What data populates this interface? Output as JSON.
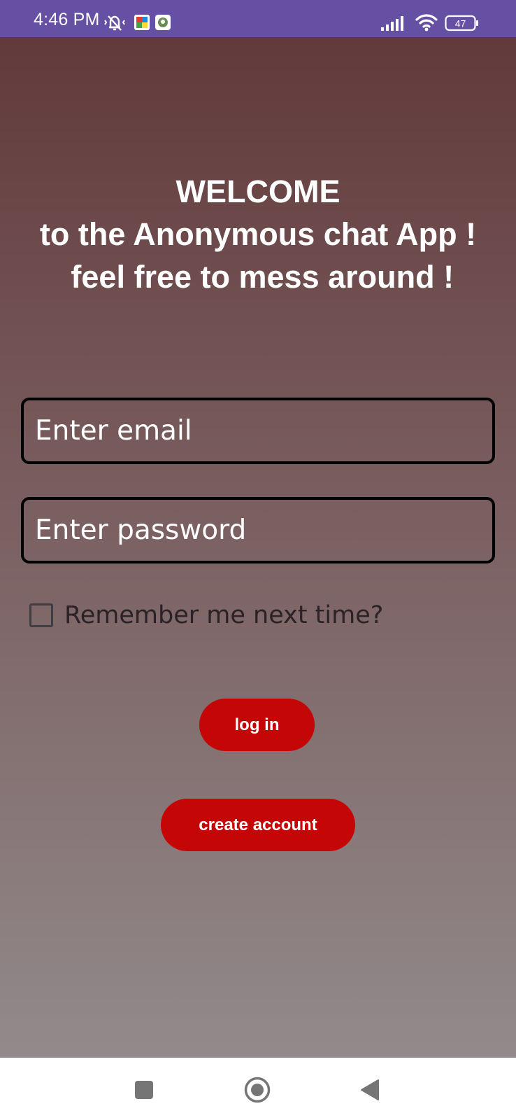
{
  "status_bar": {
    "time": "4:46 PM",
    "battery_level": "47",
    "background_color": "#6650a4",
    "icons": [
      "mute-icon",
      "app-notification-icon",
      "app-notification-icon-2",
      "signal-icon",
      "wifi-icon",
      "battery-icon"
    ]
  },
  "welcome": {
    "line1": "WELCOME",
    "line2": "to the Anonymous chat App !",
    "line3": " feel free to mess around !"
  },
  "form": {
    "email_placeholder": "Enter email",
    "email_value": "",
    "password_placeholder": "Enter password",
    "password_value": "",
    "remember_label": "Remember me next time?",
    "remember_checked": false
  },
  "buttons": {
    "login_label": "log in",
    "create_label": "create account",
    "color": "#c40606"
  },
  "nav_bar": {
    "icons": [
      "recents-square-icon",
      "home-circle-icon",
      "back-triangle-icon"
    ]
  }
}
